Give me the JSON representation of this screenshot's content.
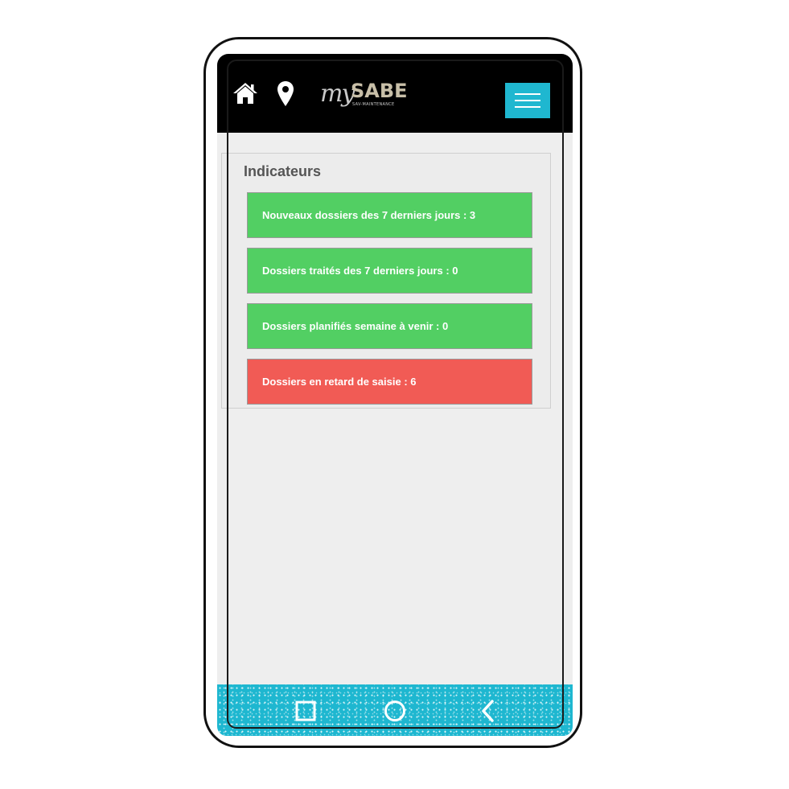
{
  "header": {
    "home_icon": "home-icon",
    "location_icon": "map-pin-icon",
    "logo": {
      "my": "my",
      "brand": "SABE",
      "subtitle": "SAV-MAINTENANCE"
    },
    "menu_icon": "hamburger-menu-icon",
    "colors": {
      "background": "#000000",
      "menu_button": "#1fb7d0"
    }
  },
  "indicators": {
    "title": "Indicateurs",
    "items": [
      {
        "label": "Nouveaux dossiers des 7 derniers jours : 3",
        "color": "#52cf63"
      },
      {
        "label": "Dossiers traités des 7 derniers jours : 0",
        "color": "#52cf63"
      },
      {
        "label": "Dossiers planifiés semaine à venir : 0",
        "color": "#52cf63"
      },
      {
        "label": "Dossiers en retard de saisie : 6",
        "color": "#f15b55"
      }
    ]
  },
  "navbar": {
    "buttons": [
      "recent-apps-icon",
      "home-circle-icon",
      "back-icon"
    ],
    "color": "#1eb7d0"
  }
}
